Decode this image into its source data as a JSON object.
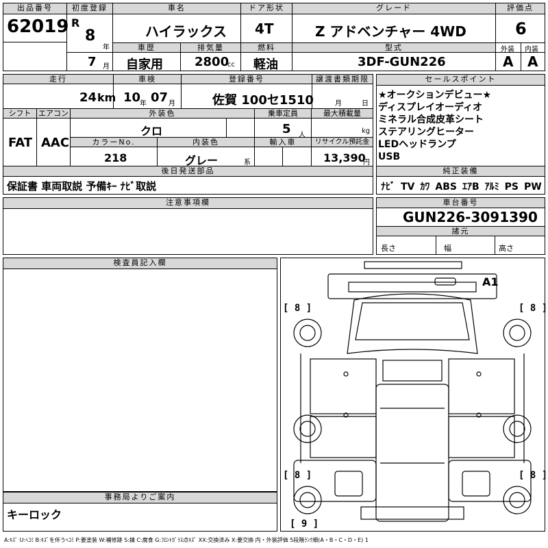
{
  "header": {
    "lot_label": "出品番号",
    "lot_number": "62019",
    "first_reg_label": "初度登録",
    "era": "R",
    "year": "8",
    "year_unit": "年",
    "month": "7",
    "month_unit": "月",
    "car_name_label": "車名",
    "car_name": "ハイラックス",
    "door_label": "ドア形状",
    "door": "4T",
    "grade_label": "グレード",
    "grade": "Z アドベンチャー 4WD",
    "score_label": "評価点",
    "score": "6",
    "history_label": "車歴",
    "history": "自家用",
    "disp_label": "排気量",
    "displacement": "2800",
    "disp_unit": "cc",
    "fuel_label": "燃料",
    "fuel": "軽油",
    "model_label": "型式",
    "model": "3DF-GUN226",
    "ext_label": "外装",
    "ext_grade": "A",
    "int_label": "内装",
    "int_grade": "A"
  },
  "row2": {
    "mileage_label": "走行",
    "mileage": "24",
    "mileage_unit": "km",
    "inspection_label": "車検",
    "insp_year": "10",
    "insp_year_unit": "年",
    "insp_month": "07",
    "insp_month_unit": "月",
    "reg_label": "登録番号",
    "reg": "佐賀 100セ1510",
    "transfer_label": "譲渡書類期限",
    "transfer_month": "月",
    "transfer_day": "日",
    "shift_label": "シフト",
    "shift": "FAT",
    "ac_label": "エアコン",
    "ac": "AAC",
    "ext_color_label": "外装色",
    "ext_color": "クロ",
    "capacity_label": "乗車定員",
    "capacity": "5",
    "capacity_unit": "人",
    "load_label": "最大積載量",
    "load_unit": "kg",
    "color_no_label": "カラーNo.",
    "color_no": "218",
    "int_color_label": "内装色",
    "int_color": "グレー",
    "int_color_unit": "系",
    "import_label": "輸入車",
    "recycle_label": "リサイクル預託金",
    "recycle": "13,390",
    "recycle_unit": "円"
  },
  "sales_points": {
    "label": "セールスポイント",
    "items": [
      "★オークションデビュー★",
      "ディスプレイオーディオ",
      "ミネラル合成皮革シート",
      "ステアリングヒーター",
      "LEDヘッドランプ",
      "USB"
    ]
  },
  "later_parts": {
    "label": "後日発送部品",
    "value": "保証書 車両取説 予備ｷｰ ﾅﾋﾞ取説"
  },
  "equipment": {
    "label": "純正装備",
    "items": [
      "ﾅﾋﾞ",
      "TV",
      "ｶﾜ",
      "ABS",
      "ｴｱB",
      "ｱﾙﾐ",
      "PS",
      "PW"
    ]
  },
  "notes": {
    "label": "注意事項欄"
  },
  "chassis": {
    "label": "車台番号",
    "value": "GUN226-3091390"
  },
  "specs": {
    "label": "諸元",
    "length": "長さ",
    "width": "幅",
    "height": "高さ"
  },
  "inspector": {
    "label": "検査員記入欄"
  },
  "office": {
    "label": "事務局よりご案内",
    "value": "キーロック"
  },
  "diagram": {
    "mark_a1": "A1",
    "tyre_fl": "[ 8 ]",
    "tyre_fr": "[ 8 ]",
    "tyre_rl": "[ 8 ]",
    "tyre_rr": "[ 8 ]",
    "spare": "[ 9 ]"
  },
  "legend": "A:ｷｽﾞ U:ﾍｺﾐ B:ｷｽﾞを伴うﾍｺﾐ P:要塗装 W:補修跡 S:錆 C:腐食 G:ﾌﾛﾝﾄｶﾞﾗｽ点ｷｽﾞ XX:交換済み X:要交換 内・外装評価 5段階ﾗﾝｸ順(A・B・C・D・E) 1"
}
